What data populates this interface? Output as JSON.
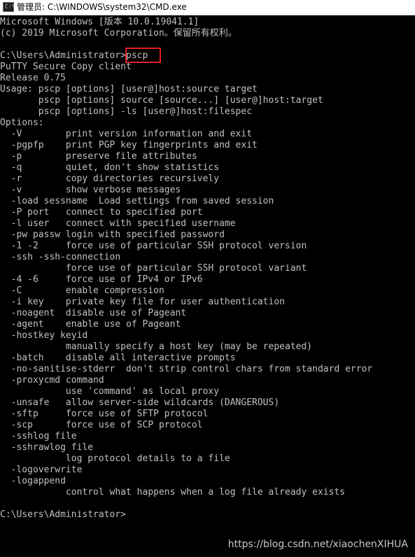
{
  "window": {
    "title": "管理员: C:\\WINDOWS\\system32\\CMD.exe",
    "icon": "cmd-icon",
    "icon_glyph": "C:\\"
  },
  "console": {
    "lines": [
      "Microsoft Windows [版本 10.0.19041.1]",
      "(c) 2019 Microsoft Corporation。保留所有权利。",
      "",
      "C:\\Users\\Administrator>pscp",
      "PuTTY Secure Copy client",
      "Release 0.75",
      "Usage: pscp [options] [user@]host:source target",
      "       pscp [options] source [source...] [user@]host:target",
      "       pscp [options] -ls [user@]host:filespec",
      "Options:",
      "  -V        print version information and exit",
      "  -pgpfp    print PGP key fingerprints and exit",
      "  -p        preserve file attributes",
      "  -q        quiet, don't show statistics",
      "  -r        copy directories recursively",
      "  -v        show verbose messages",
      "  -load sessname  Load settings from saved session",
      "  -P port   connect to specified port",
      "  -l user   connect with specified username",
      "  -pw passw login with specified password",
      "  -1 -2     force use of particular SSH protocol version",
      "  -ssh -ssh-connection",
      "            force use of particular SSH protocol variant",
      "  -4 -6     force use of IPv4 or IPv6",
      "  -C        enable compression",
      "  -i key    private key file for user authentication",
      "  -noagent  disable use of Pageant",
      "  -agent    enable use of Pageant",
      "  -hostkey keyid",
      "            manually specify a host key (may be repeated)",
      "  -batch    disable all interactive prompts",
      "  -no-sanitise-stderr  don't strip control chars from standard error",
      "  -proxycmd command",
      "            use 'command' as local proxy",
      "  -unsafe   allow server-side wildcards (DANGEROUS)",
      "  -sftp     force use of SFTP protocol",
      "  -scp      force use of SCP protocol",
      "  -sshlog file",
      "  -sshrawlog file",
      "            log protocol details to a file",
      "  -logoverwrite",
      "  -logappend",
      "            control what happens when a log file already exists",
      "",
      "C:\\Users\\Administrator>"
    ]
  },
  "watermark": "https://blog.csdn.net/xiaochenXIHUA",
  "colors": {
    "background": "#000000",
    "text": "#c0c0c0",
    "highlight": "#e02020"
  }
}
